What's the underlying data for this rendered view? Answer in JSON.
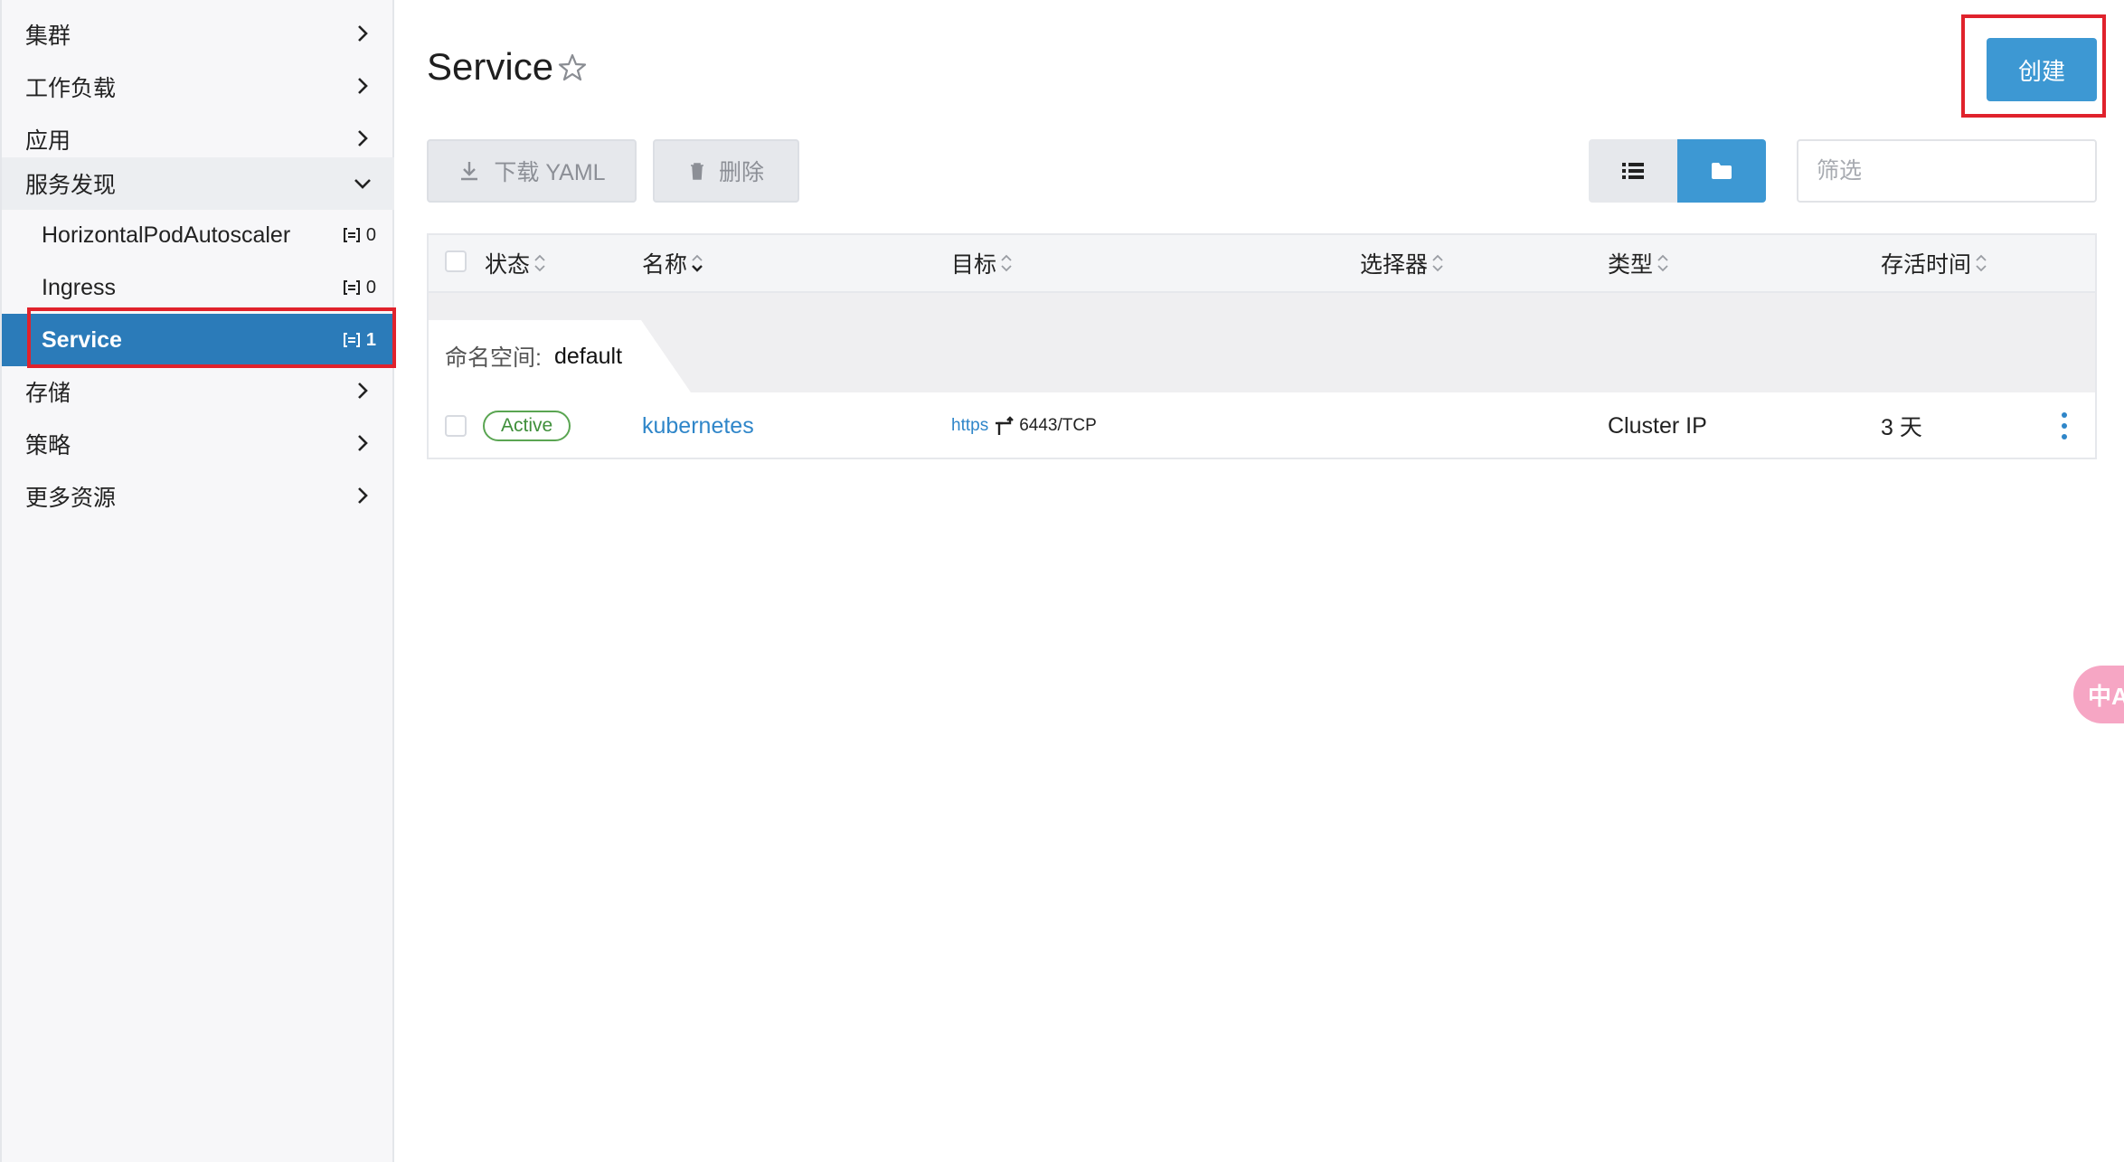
{
  "sidebar": {
    "groups": {
      "cluster": "集群",
      "workload": "工作负载",
      "apps": "应用",
      "service_discovery": "服务发现",
      "storage": "存储",
      "policy": "策略",
      "more_resources": "更多资源"
    },
    "sub_items": [
      {
        "label": "HorizontalPodAutoscaler",
        "count": "0"
      },
      {
        "label": "Ingress",
        "count": "0"
      },
      {
        "label": "Service",
        "count": "1"
      }
    ]
  },
  "header": {
    "title": "Service",
    "create_label": "创建"
  },
  "toolbar": {
    "download_yaml_label": "下载 YAML",
    "delete_label": "删除",
    "filter_placeholder": "筛选"
  },
  "table": {
    "columns": [
      "状态",
      "名称",
      "目标",
      "选择器",
      "类型",
      "存活时间"
    ],
    "namespace_label": "命名空间:",
    "namespace_value": "default",
    "rows": [
      {
        "status": "Active",
        "name": "kubernetes",
        "target_protocol": "https",
        "target_port": "6443/TCP",
        "selector": "",
        "type": "Cluster IP",
        "age": "3 天"
      }
    ]
  },
  "translate_button": "中A",
  "colors": {
    "accent": "#2b7bb9",
    "create_button": "#3d98d3",
    "highlight_box": "#e0222c",
    "active_badge": "#5aa552",
    "link": "#2f86c9"
  }
}
